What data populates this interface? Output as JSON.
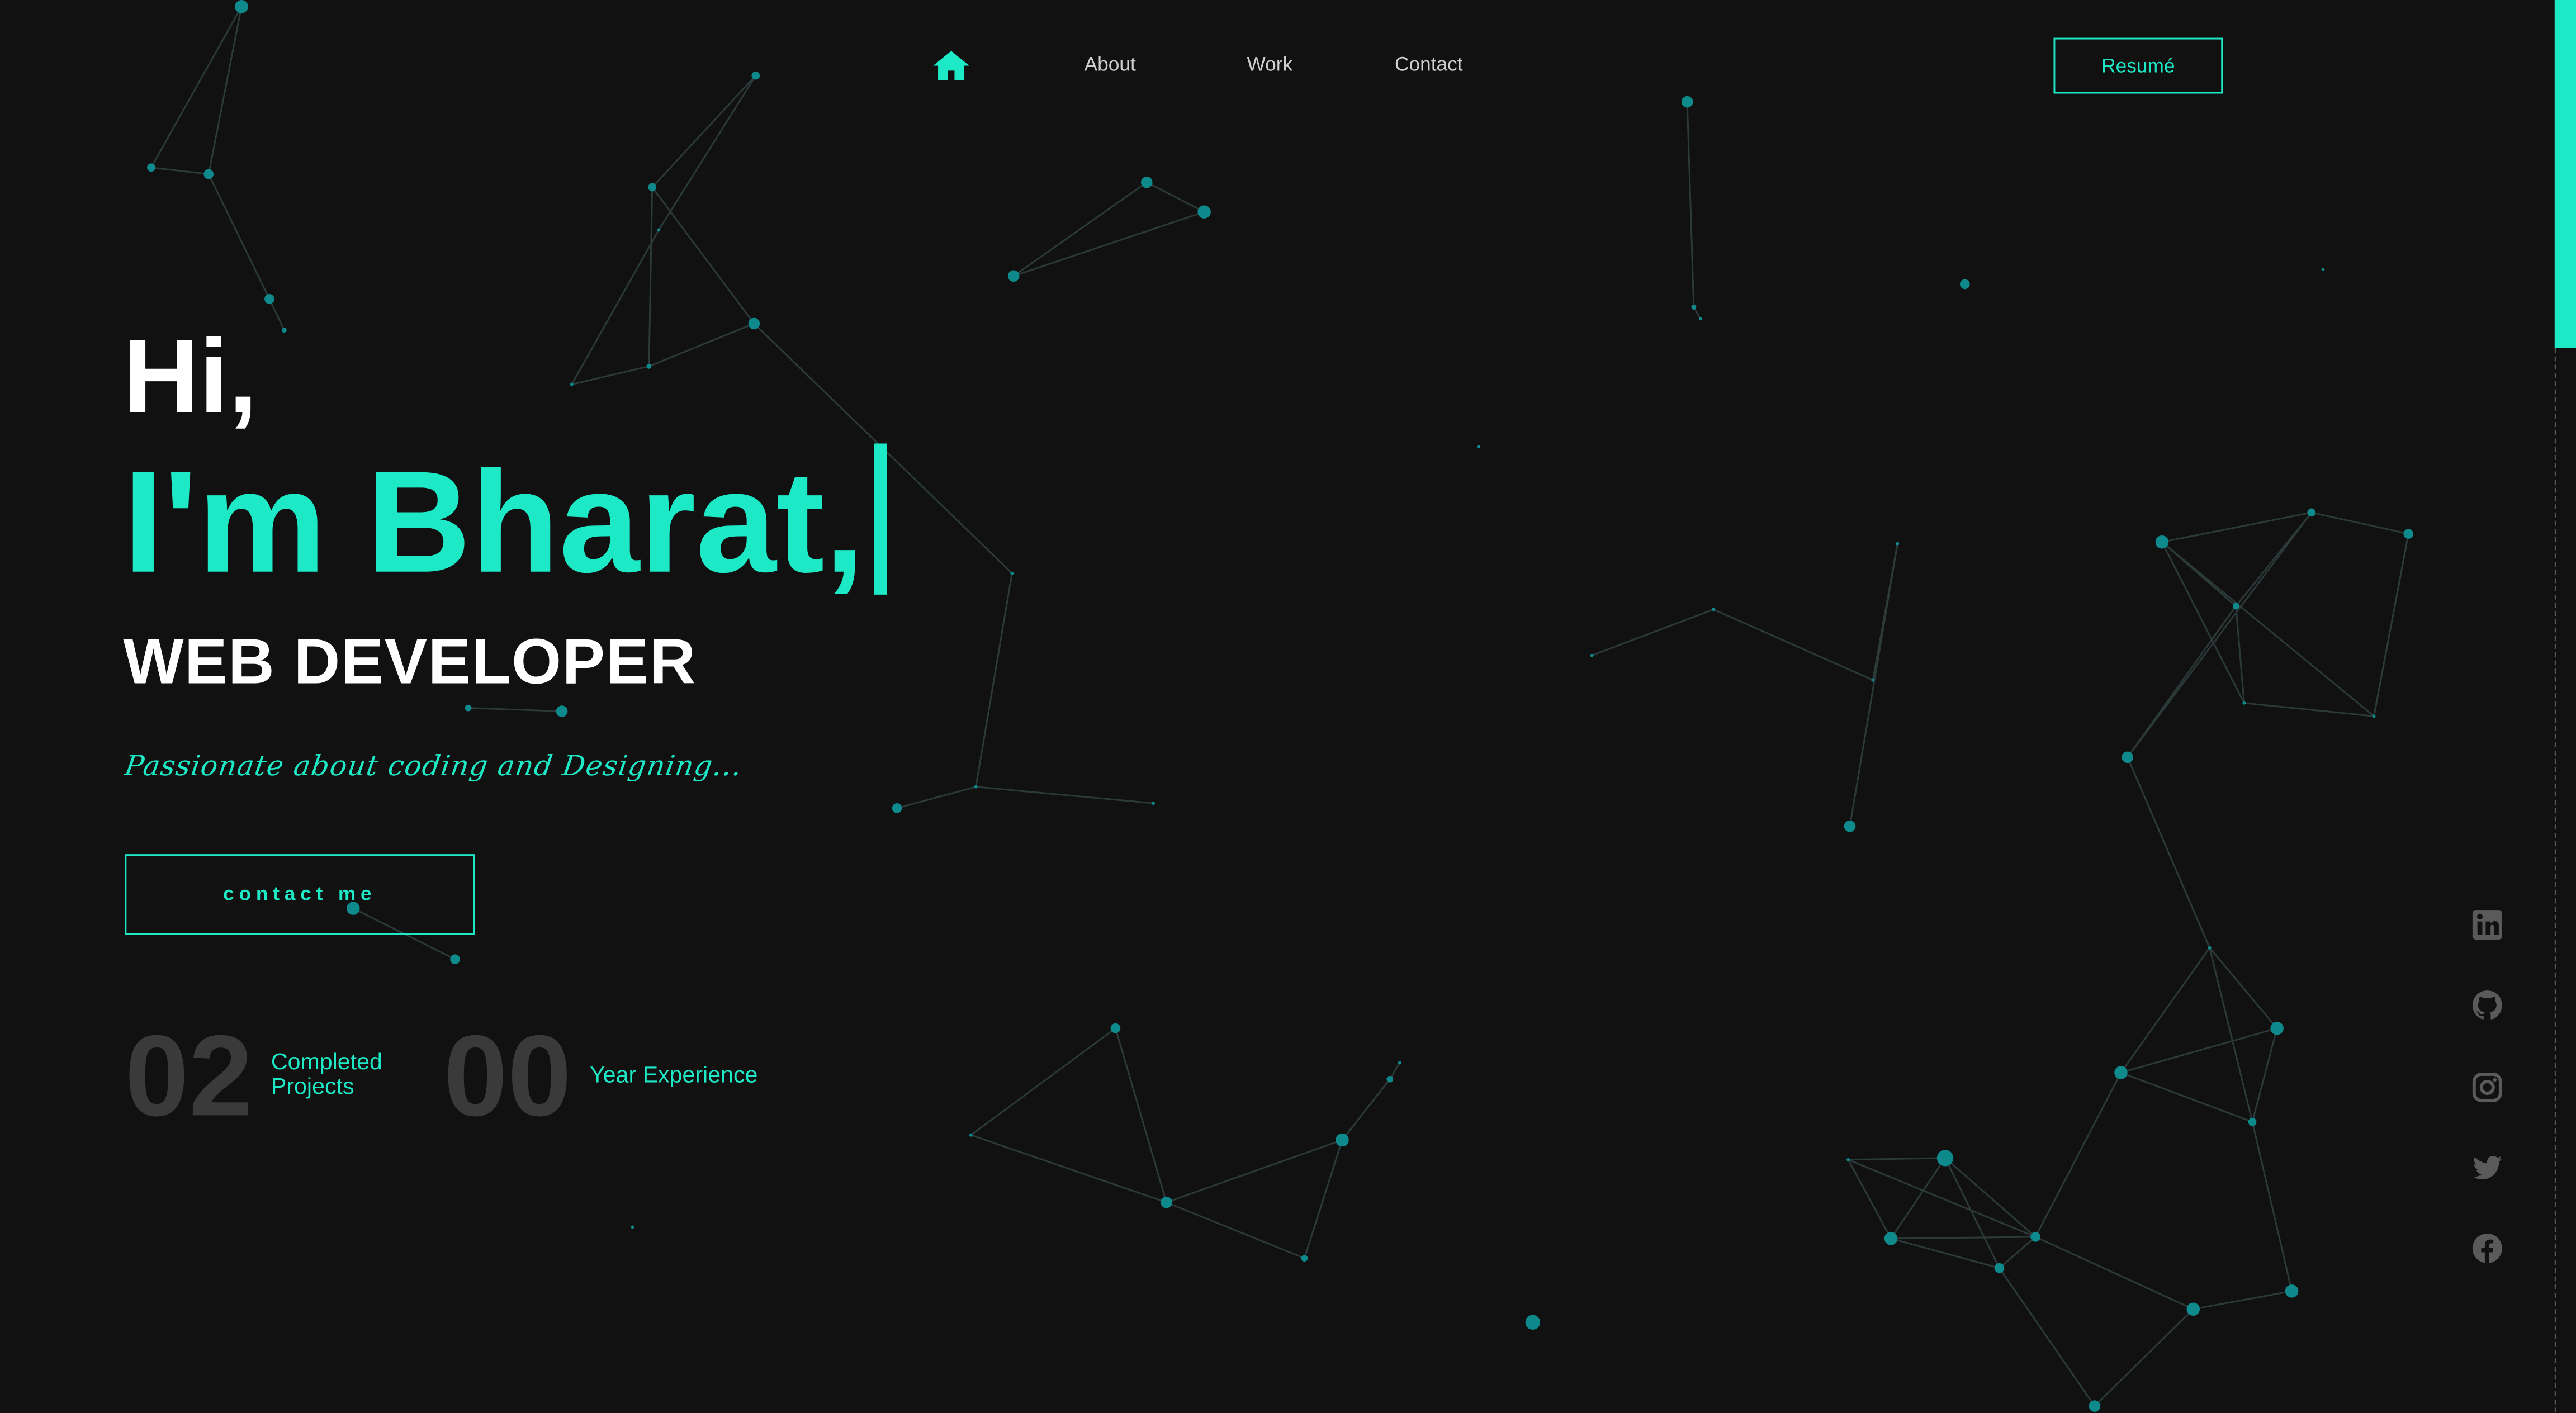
{
  "nav": {
    "home_icon": "home-icon",
    "links": [
      "About",
      "Work",
      "Contact"
    ],
    "resume_label": "Resumé"
  },
  "hero": {
    "greeting": "Hi,",
    "name": "I'm Bharat,",
    "role": "WEB DEVELOPER",
    "tagline": "Passionate about coding and Designing...",
    "cta_label": "contact me"
  },
  "stats": [
    {
      "value": "02",
      "label": "Completed Projects"
    },
    {
      "value": "00",
      "label": "Year Experience"
    }
  ],
  "social_icons": [
    "linkedin-icon",
    "github-icon",
    "instagram-icon",
    "twitter-icon",
    "facebook-icon"
  ],
  "colors": {
    "background": "#111111",
    "accent": "#1de9c6",
    "particle": "#0e7c80",
    "stat_number": "#3a3a3a",
    "social_icon": "#5a5a5a"
  }
}
